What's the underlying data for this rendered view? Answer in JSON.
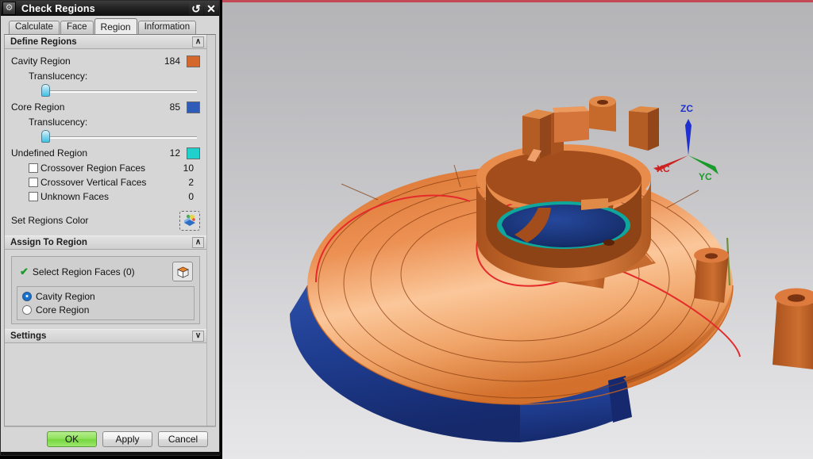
{
  "window": {
    "title": "Check Regions",
    "icon": "gear-icon",
    "buttons": [
      {
        "name": "reset-button",
        "glyph": "↺"
      },
      {
        "name": "close-button",
        "glyph": "✕"
      }
    ]
  },
  "tabs": [
    {
      "label": "Calculate",
      "active": false
    },
    {
      "label": "Face",
      "active": false
    },
    {
      "label": "Region",
      "active": true
    },
    {
      "label": "Information",
      "active": false
    }
  ],
  "define_regions": {
    "header": "Define Regions",
    "collapse_glyph": "∧",
    "cavity": {
      "label": "Cavity Region",
      "count": "184",
      "color": "#d4672b",
      "translucency_label": "Translucency:",
      "translucency_value": 0
    },
    "core": {
      "label": "Core Region",
      "count": "85",
      "color": "#2e5cb8",
      "translucency_label": "Translucency:",
      "translucency_value": 0
    },
    "undefined": {
      "label": "Undefined Region",
      "count": "12",
      "color": "#20d0cc"
    },
    "checkboxes": [
      {
        "label": "Crossover Region Faces",
        "count": "10",
        "checked": false
      },
      {
        "label": "Crossover Vertical Faces",
        "count": "2",
        "checked": false
      },
      {
        "label": "Unknown Faces",
        "count": "0",
        "checked": false
      }
    ],
    "set_regions_color": {
      "label": "Set Regions Color",
      "icon": "color-palette-icon"
    }
  },
  "assign_to_region": {
    "header": "Assign To Region",
    "collapse_glyph": "∧",
    "select_faces": {
      "label": "Select Region Faces (0)",
      "check_glyph": "✔",
      "icon": "select-face-cube-icon"
    },
    "radios": [
      {
        "label": "Cavity Region",
        "selected": true
      },
      {
        "label": "Core Region",
        "selected": false
      }
    ]
  },
  "settings": {
    "header": "Settings",
    "expand_glyph": "∨"
  },
  "footer": {
    "ok": "OK",
    "apply": "Apply",
    "cancel": "Cancel"
  },
  "viewport": {
    "triad": [
      {
        "axis": "ZC",
        "color": "#2030d0"
      },
      {
        "axis": "XC",
        "color": "#cc2222"
      },
      {
        "axis": "YC",
        "color": "#1a9a2a"
      }
    ],
    "model_colors": {
      "cavity_orange": "#e8823c",
      "cavity_orange_dark": "#b85a22",
      "core_blue": "#1b3a8c",
      "undefined_teal": "#0fa89c",
      "parting_line_red": "#e03030"
    }
  }
}
